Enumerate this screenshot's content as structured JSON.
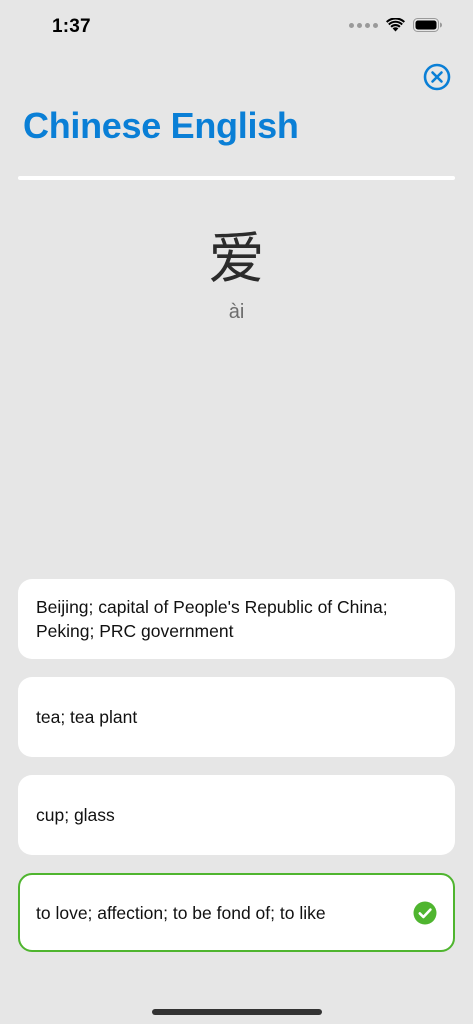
{
  "status_bar": {
    "time": "1:37"
  },
  "header": {
    "title": "Chinese English"
  },
  "card": {
    "character": "爱",
    "pinyin": "ài"
  },
  "options": [
    {
      "text": "Beijing; capital of People's Republic of China; Peking; PRC government",
      "correct": false
    },
    {
      "text": "tea; tea plant",
      "correct": false
    },
    {
      "text": "cup; glass",
      "correct": false
    },
    {
      "text": "to love; affection; to be fond of; to like",
      "correct": true
    }
  ],
  "icons": {
    "close": "close-circle-icon",
    "check": "checkmark-circle-icon"
  },
  "colors": {
    "accent": "#0a7fd6",
    "correct": "#4fb52f",
    "background": "#e6e6e6"
  }
}
